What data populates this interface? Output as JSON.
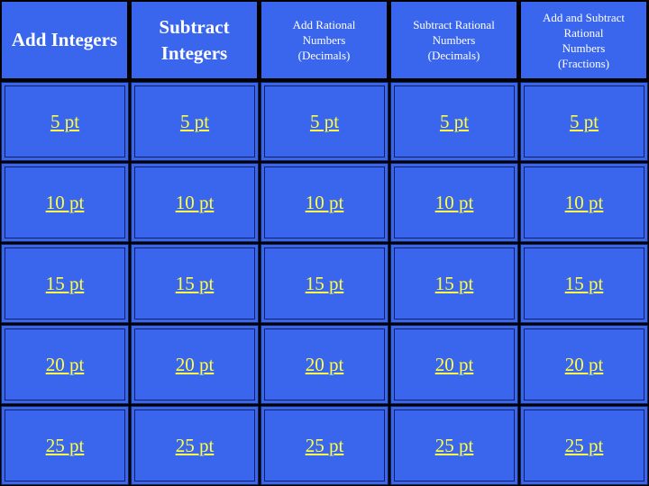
{
  "categories": [
    {
      "label": "Add Integers",
      "size": "big"
    },
    {
      "label": "Subtract Integers",
      "size": "big"
    },
    {
      "label": "Add Rational Numbers (Decimals)",
      "size": "small"
    },
    {
      "label": "Subtract Rational Numbers (Decimals)",
      "size": "small"
    },
    {
      "label": "Add and Subtract Rational Numbers (Fractions)",
      "size": "small"
    }
  ],
  "points": [
    "5 pt",
    "10 pt",
    "15 pt",
    "20 pt",
    "25 pt"
  ],
  "colors": {
    "cell": "#3a66ee",
    "link": "#ffff44",
    "header_text": "#ffffff",
    "grid": "#000000"
  }
}
